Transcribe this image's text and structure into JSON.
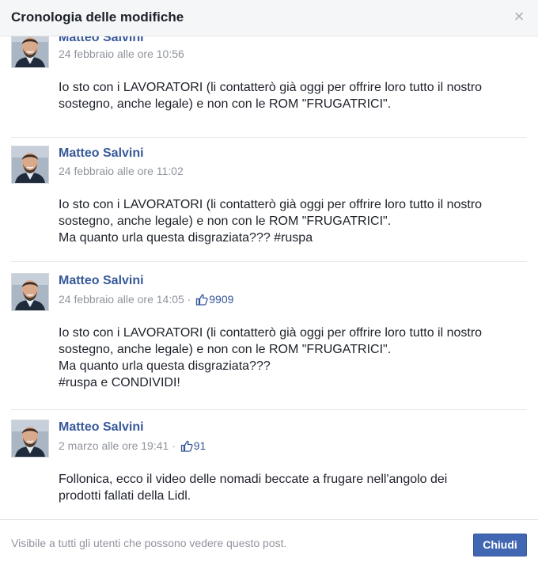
{
  "dialog": {
    "title": "Cronologia delle modifiche",
    "close_icon": "close-icon",
    "footer_note": "Visibile a tutti gli utenti che possono vedere questo post.",
    "close_button": "Chiudi"
  },
  "colors": {
    "author": "#365899",
    "meta": "#90949c",
    "button": "#4267b2"
  },
  "entries": [
    {
      "author": "Matteo Salvini",
      "timestamp": "24 febbraio alle ore 10:56",
      "likes": "",
      "lines": [
        "Io sto con i LAVORATORI (li contatterò già oggi per offrire loro tutto il nostro",
        "sostegno, anche legale) e non con le ROM \"FRUGATRICI\"."
      ]
    },
    {
      "author": "Matteo Salvini",
      "timestamp": "24 febbraio alle ore 11:02",
      "likes": "",
      "lines": [
        "Io sto con i LAVORATORI (li contatterò già oggi per offrire loro tutto il nostro",
        "sostegno, anche legale) e non con le ROM \"FRUGATRICI\".",
        "Ma quanto urla questa disgraziata??? #ruspa"
      ]
    },
    {
      "author": "Matteo Salvini",
      "timestamp": "24 febbraio alle ore 14:05",
      "separator": " · ",
      "likes": "9909",
      "lines": [
        "Io sto con i LAVORATORI (li contatterò già oggi per offrire loro tutto il nostro",
        "sostegno, anche legale) e non con le ROM \"FRUGATRICI\".",
        "Ma quanto urla questa disgraziata???",
        "#ruspa e CONDIVIDI!"
      ]
    },
    {
      "author": "Matteo Salvini",
      "timestamp": "2 marzo alle ore 19:41",
      "separator": " · ",
      "likes": "91",
      "lines": [
        "Follonica, ecco il video delle nomadi beccate a frugare nell'angolo dei",
        "prodotti fallati della Lidl."
      ]
    }
  ]
}
